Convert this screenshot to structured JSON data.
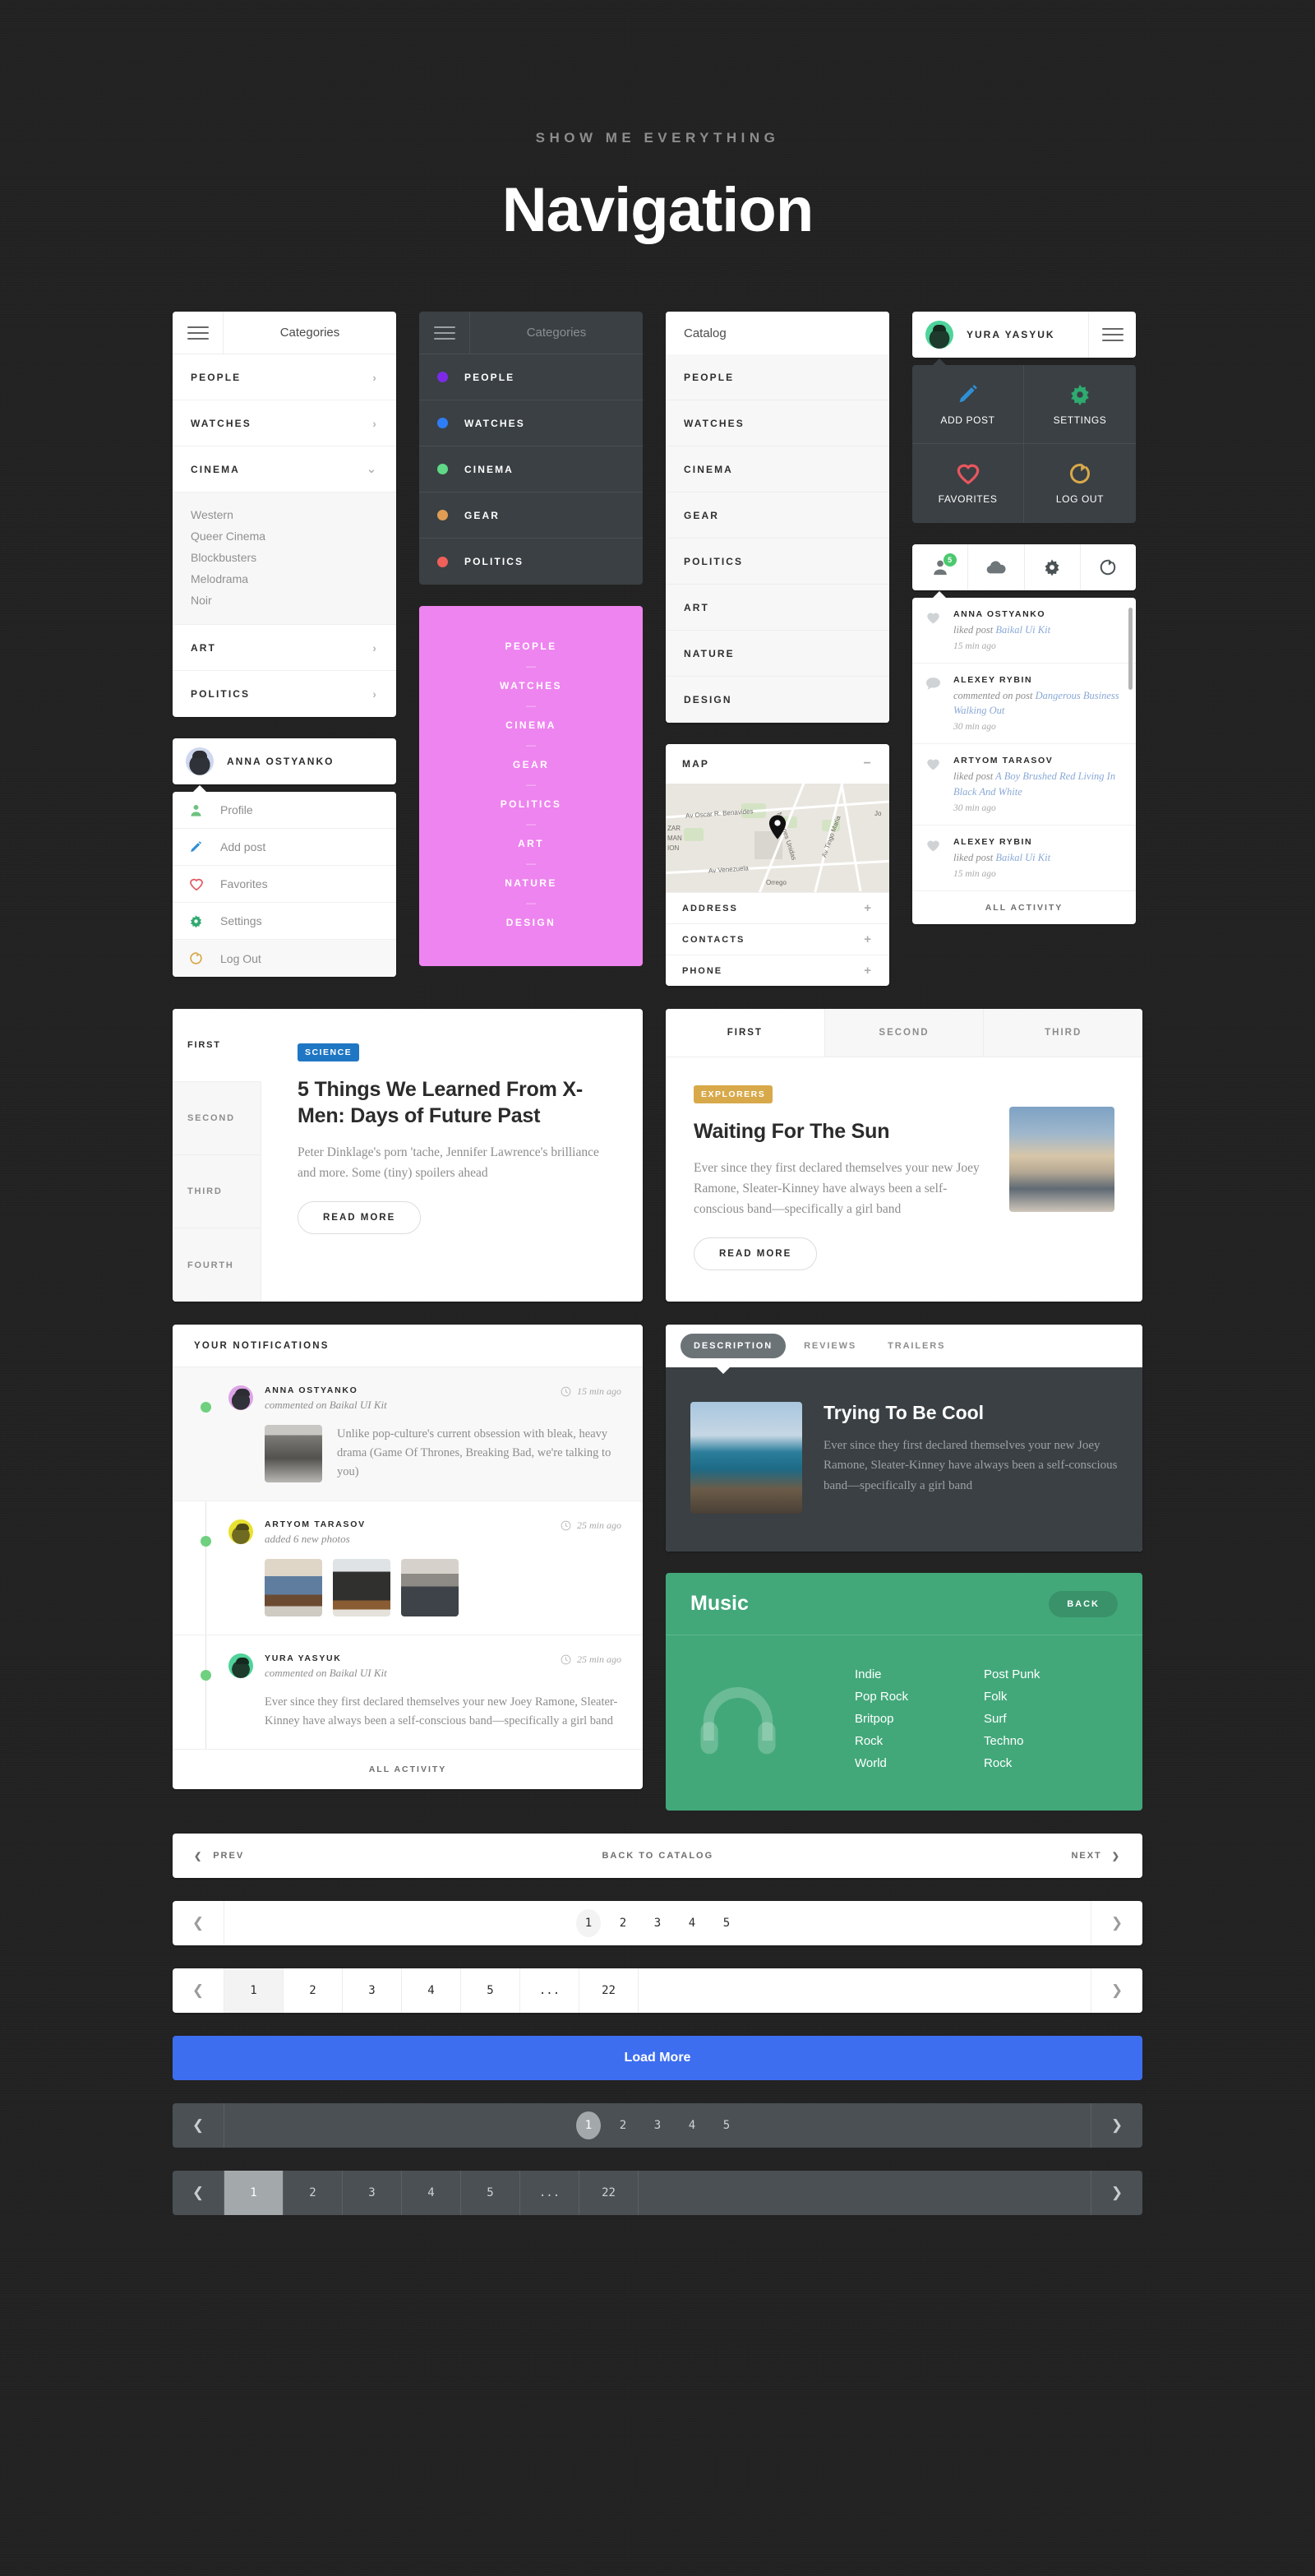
{
  "header": {
    "kicker": "SHOW ME EVERYTHING",
    "title": "Navigation"
  },
  "colors": {
    "page_bg": "#222222",
    "dark_panel": "#3a4043",
    "pink": "#ee84ef",
    "green": "#42a87a",
    "blue": "#3d6ef0",
    "accent_blue_tag": "#1f77c4",
    "accent_gold_tag": "#d8a94a",
    "dot_people": "#7c2ae8",
    "dot_watches": "#2f7df6",
    "dot_cinema": "#5fd887",
    "dot_gear": "#df9e54",
    "dot_politics": "#f0605a",
    "badge_green": "#4cc96f"
  },
  "categories_light": {
    "menu_label": "Categories",
    "items": [
      {
        "label": "PEOPLE",
        "chevron": "chevron-right"
      },
      {
        "label": "WATCHES",
        "chevron": "chevron-right"
      },
      {
        "label": "CINEMA",
        "chevron": "chevron-down",
        "expanded": true
      }
    ],
    "sub_items": [
      "Western",
      "Queer Cinema",
      "Blockbusters",
      "Melodrama",
      "Noir"
    ],
    "items_after": [
      {
        "label": "ART",
        "chevron": "chevron-right"
      },
      {
        "label": "POLITICS",
        "chevron": "chevron-right"
      }
    ]
  },
  "profile_anna": {
    "name": "ANNA OSTYANKO",
    "menu": [
      {
        "label": "Profile",
        "icon": "user-icon",
        "color": "#6fc17f"
      },
      {
        "label": "Add post",
        "icon": "pencil-icon",
        "color": "#2f8fd4"
      },
      {
        "label": "Favorites",
        "icon": "heart-icon",
        "color": "#e05c63"
      },
      {
        "label": "Settings",
        "icon": "gear-icon",
        "color": "#2faa70"
      },
      {
        "label": "Log Out",
        "icon": "logout-icon",
        "color": "#d2a council"
      }
    ]
  },
  "categories_dark": {
    "menu_label": "Categories",
    "items": [
      {
        "label": "PEOPLE",
        "dot": "#7c2ae8"
      },
      {
        "label": "WATCHES",
        "dot": "#2f7df6"
      },
      {
        "label": "CINEMA",
        "dot": "#5fd887"
      },
      {
        "label": "GEAR",
        "dot": "#df9e54"
      },
      {
        "label": "POLITICS",
        "dot": "#f0605a"
      }
    ]
  },
  "pink_menu": {
    "items": [
      "PEOPLE",
      "WATCHES",
      "CINEMA",
      "GEAR",
      "POLITICS",
      "ART",
      "NATURE",
      "DESIGN"
    ],
    "separator": "—"
  },
  "catalog": {
    "title": "Catalog",
    "items": [
      "PEOPLE",
      "WATCHES",
      "CINEMA",
      "GEAR",
      "POLITICS",
      "ART",
      "NATURE",
      "DESIGN"
    ]
  },
  "map_widget": {
    "title": "MAP",
    "collapse_icon": "minus-icon",
    "street_labels": [
      "Av Oscar R. Benavides",
      "Naciones Unidas",
      "Av Venezuela",
      "Orrego",
      "Av Tingo Maria",
      "ZAR",
      "MAN",
      "ION",
      "Jo"
    ],
    "accordions": [
      {
        "label": "ADDRESS",
        "icon": "plus-icon"
      },
      {
        "label": "CONTACTS",
        "icon": "plus-icon"
      },
      {
        "label": "PHONE",
        "icon": "plus-icon"
      }
    ]
  },
  "profile_yura": {
    "name": "YURA YASYUK",
    "actions": [
      {
        "label": "ADD POST",
        "icon": "pencil-icon",
        "color": "#2f8fd4"
      },
      {
        "label": "SETTINGS",
        "icon": "gear-icon",
        "color": "#2faa70"
      },
      {
        "label": "FAVORITES",
        "icon": "heart-icon",
        "color": "#e8565f"
      },
      {
        "label": "LOG OUT",
        "icon": "logout-icon",
        "color": "#d8a94a"
      }
    ]
  },
  "notif_tabs": {
    "tabs": [
      {
        "icon": "user-icon",
        "badge": "5",
        "active": true
      },
      {
        "icon": "cloud-upload-icon",
        "badge": null
      },
      {
        "icon": "gear-icon",
        "badge": null
      },
      {
        "icon": "logout-icon",
        "badge": null
      }
    ],
    "all_activity": "ALL ACTIVITY",
    "items": [
      {
        "icon": "heart-icon",
        "name": "ANNA OSTYANKO",
        "action": "liked post ",
        "link": "Baikal Ui Kit",
        "time": "15 min ago"
      },
      {
        "icon": "comment-icon",
        "name": "ALEXEY RYBIN",
        "action": "commented on post ",
        "link": "Dangerous Business Walking Out",
        "time": "30 min ago"
      },
      {
        "icon": "heart-icon",
        "name": "ARTYOM TARASOV",
        "action": "liked post ",
        "link": "A Boy Brushed Red Living In Black And White",
        "time": "30 min ago"
      },
      {
        "icon": "heart-icon",
        "name": "ALEXEY RYBIN",
        "action": "liked post ",
        "link": "Baikal Ui Kit",
        "time": "15 min ago"
      }
    ]
  },
  "article_vertical": {
    "tabs": [
      {
        "label": "FIRST",
        "active": true
      },
      {
        "label": "SECOND",
        "active": false
      },
      {
        "label": "THIRD",
        "active": false
      },
      {
        "label": "FOURTH",
        "active": false
      }
    ],
    "tag": "SCIENCE",
    "tag_color": "#1f77c4",
    "title": "5 Things We Learned From X-Men: Days of Future Past",
    "excerpt": "Peter Dinklage's porn 'tache, Jennifer Lawrence's brilliance and more. Some (tiny) spoilers ahead",
    "button": "READ MORE"
  },
  "article_horizontal": {
    "tabs": [
      {
        "label": "FIRST",
        "active": true
      },
      {
        "label": "SECOND",
        "active": false
      },
      {
        "label": "THIRD",
        "active": false
      }
    ],
    "tag": "EXPLORERS",
    "tag_color": "#d8a94a",
    "title": "Waiting For The Sun",
    "excerpt": "Ever since they first declared themselves your new Joey Ramone, Sleater-Kinney have always been a self-conscious band—specifically a girl band",
    "button": "READ MORE",
    "image_alt": "clouds-photo"
  },
  "notifications_panel": {
    "title": "YOUR NOTIFICATIONS",
    "all_activity": "ALL ACTIVITY",
    "events": [
      {
        "name": "ANNA OSTYANKO",
        "action": "commented on Baikal UI Kit",
        "time": "15 min ago",
        "text": "Unlike pop-culture's current obsession with bleak, heavy drama (Game Of Thrones, Breaking Bad, we're talking to you)",
        "has_photo": true
      },
      {
        "name": "ARTYOM TARASOV",
        "action": "added 6 new photos",
        "time": "25 min ago",
        "photo_count": 3
      },
      {
        "name": "YURA YASYUK",
        "action": "commented on Baikal UI Kit",
        "time": "25 min ago",
        "text": "Ever since they first declared themselves your new Joey Ramone, Sleater-Kinney have always been a self-conscious band—specifically a girl band"
      }
    ]
  },
  "description_card": {
    "tabs": [
      {
        "label": "DESCRIPTION",
        "active": true
      },
      {
        "label": "REVIEWS",
        "active": false
      },
      {
        "label": "TRAILERS",
        "active": false
      }
    ],
    "title": "Trying To Be Cool",
    "text": "Ever since they first declared themselves your new Joey Ramone, Sleater-Kinney have always been a self-conscious band—specifically a girl band",
    "image_alt": "coast-photo"
  },
  "music_card": {
    "title": "Music",
    "back_label": "BACK",
    "icon": "headphones-icon",
    "column_left": [
      "Indie",
      "Pop Rock",
      "Britpop",
      "Rock",
      "World"
    ],
    "column_right": [
      "Post Punk",
      "Folk",
      "Surf",
      "Techno",
      "Rock"
    ]
  },
  "prevnext": {
    "prev": "PREV",
    "middle": "BACK TO CATALOG",
    "next": "NEXT"
  },
  "pagination_simple": {
    "pages": [
      "1",
      "2",
      "3",
      "4",
      "5"
    ],
    "active": "1",
    "prev_icon": "chevron-left",
    "next_icon": "chevron-right"
  },
  "pagination_cells": {
    "pages": [
      "1",
      "2",
      "3",
      "4",
      "5",
      "...",
      "22"
    ],
    "active": "1",
    "prev_icon": "chevron-left",
    "next_icon": "chevron-right"
  },
  "load_more": {
    "label": "Load More"
  },
  "pagination_simple_dark": {
    "pages": [
      "1",
      "2",
      "3",
      "4",
      "5"
    ],
    "active": "1"
  },
  "pagination_cells_dark": {
    "pages": [
      "1",
      "2",
      "3",
      "4",
      "5",
      "...",
      "22"
    ],
    "active": "1"
  }
}
